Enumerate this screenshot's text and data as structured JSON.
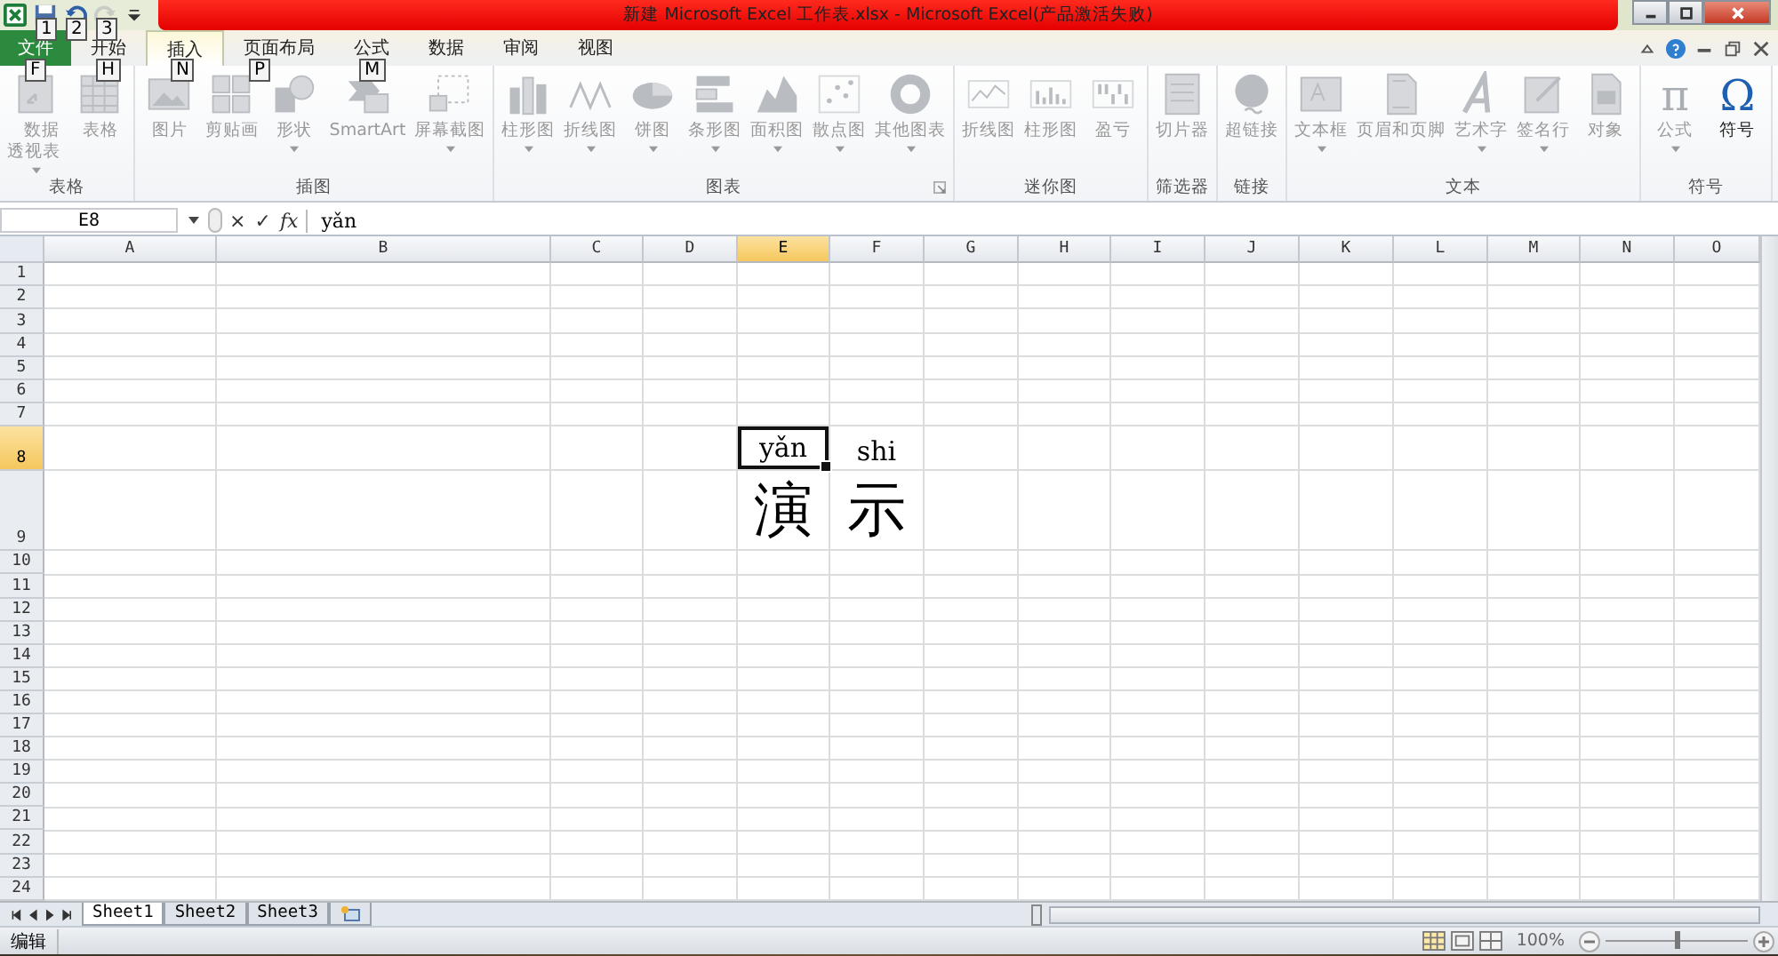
{
  "title_bar": {
    "title": "新建 Microsoft Excel 工作表.xlsx  -  Microsoft Excel(产品激活失败)"
  },
  "quick_access": [
    {
      "kind": "save",
      "keytip": "1",
      "disabled": false
    },
    {
      "kind": "undo",
      "keytip": "2",
      "disabled": false
    },
    {
      "kind": "redo",
      "keytip": "3",
      "disabled": true
    }
  ],
  "ribbon_tabs": [
    {
      "label": "文件",
      "kind": "file",
      "keytip": "F",
      "selected": false
    },
    {
      "label": "开始",
      "kind": "tab",
      "keytip": "H",
      "selected": false
    },
    {
      "label": "插入",
      "kind": "tab",
      "keytip": "N",
      "selected": true
    },
    {
      "label": "页面布局",
      "kind": "tab",
      "keytip": "P",
      "selected": false
    },
    {
      "label": "公式",
      "kind": "tab",
      "keytip": "M",
      "selected": false
    },
    {
      "label": "数据",
      "kind": "tab",
      "selected": false
    },
    {
      "label": "审阅",
      "kind": "tab",
      "selected": false
    },
    {
      "label": "视图",
      "kind": "tab",
      "selected": false
    }
  ],
  "ribbon_groups": [
    {
      "label": "表格",
      "buttons": [
        {
          "label": "数据透视表",
          "kind": "pivot",
          "disabled": true,
          "dropdown": true
        },
        {
          "label": "表格",
          "kind": "table",
          "disabled": true,
          "dropdown": false
        }
      ]
    },
    {
      "label": "插图",
      "buttons": [
        {
          "label": "图片",
          "kind": "picture",
          "disabled": true,
          "dropdown": false
        },
        {
          "label": "剪贴画",
          "kind": "clipart",
          "disabled": true,
          "dropdown": false
        },
        {
          "label": "形状",
          "kind": "shapes",
          "disabled": true,
          "dropdown": true
        },
        {
          "label": "SmartArt",
          "kind": "smartart",
          "disabled": true,
          "dropdown": false
        },
        {
          "label": "屏幕截图",
          "kind": "screenshot",
          "disabled": true,
          "dropdown": true
        }
      ]
    },
    {
      "label": "图表",
      "launcher": true,
      "buttons": [
        {
          "label": "柱形图",
          "kind": "column",
          "disabled": true,
          "dropdown": true
        },
        {
          "label": "折线图",
          "kind": "line",
          "disabled": true,
          "dropdown": true
        },
        {
          "label": "饼图",
          "kind": "pie",
          "disabled": true,
          "dropdown": true
        },
        {
          "label": "条形图",
          "kind": "bar",
          "disabled": true,
          "dropdown": true
        },
        {
          "label": "面积图",
          "kind": "area",
          "disabled": true,
          "dropdown": true
        },
        {
          "label": "散点图",
          "kind": "scatter",
          "disabled": true,
          "dropdown": true
        },
        {
          "label": "其他图表",
          "kind": "donut",
          "disabled": true,
          "dropdown": true
        }
      ]
    },
    {
      "label": "迷你图",
      "buttons": [
        {
          "label": "折线图",
          "kind": "sparkline",
          "disabled": true,
          "dropdown": false
        },
        {
          "label": "柱形图",
          "kind": "sparkcolumn",
          "disabled": true,
          "dropdown": false
        },
        {
          "label": "盈亏",
          "kind": "winloss",
          "disabled": true,
          "dropdown": false
        }
      ]
    },
    {
      "label": "筛选器",
      "buttons": [
        {
          "label": "切片器",
          "kind": "slicer",
          "disabled": true,
          "dropdown": false
        }
      ]
    },
    {
      "label": "链接",
      "buttons": [
        {
          "label": "超链接",
          "kind": "globe",
          "disabled": true,
          "dropdown": false
        }
      ]
    },
    {
      "label": "文本",
      "buttons": [
        {
          "label": "文本框",
          "kind": "textbox",
          "disabled": true,
          "dropdown": true
        },
        {
          "label": "页眉和页脚",
          "kind": "document",
          "disabled": true,
          "dropdown": false
        },
        {
          "label": "艺术字",
          "kind": "wordart",
          "disabled": true,
          "dropdown": true
        },
        {
          "label": "签名行",
          "kind": "signature",
          "disabled": true,
          "dropdown": true
        },
        {
          "label": "对象",
          "kind": "object",
          "disabled": true,
          "dropdown": false
        }
      ]
    },
    {
      "label": "符号",
      "buttons": [
        {
          "label": "公式",
          "kind": "glyph",
          "glyph": "π",
          "disabled": true,
          "dropdown": true
        },
        {
          "label": "符号",
          "kind": "glyph",
          "glyph": "Ω",
          "disabled": false,
          "dropdown": false
        }
      ]
    }
  ],
  "formula_bar": {
    "name_box": "E8",
    "cancel": "×",
    "enter": "✓",
    "function": "fx",
    "value": "yǎn"
  },
  "columns": [
    {
      "label": "A",
      "selected": false
    },
    {
      "label": "B",
      "selected": false
    },
    {
      "label": "C",
      "selected": false
    },
    {
      "label": "D",
      "selected": false
    },
    {
      "label": "E",
      "selected": true
    },
    {
      "label": "F",
      "selected": false
    },
    {
      "label": "G",
      "selected": false
    },
    {
      "label": "H",
      "selected": false
    },
    {
      "label": "I",
      "selected": false
    },
    {
      "label": "J",
      "selected": false
    },
    {
      "label": "K",
      "selected": false
    },
    {
      "label": "L",
      "selected": false
    },
    {
      "label": "M",
      "selected": false
    },
    {
      "label": "N",
      "selected": false
    },
    {
      "label": "O",
      "selected": false
    }
  ],
  "rows": [
    {
      "header": "1",
      "selected": false
    },
    {
      "header": "2",
      "selected": false
    },
    {
      "header": "3",
      "selected": false
    },
    {
      "header": "4",
      "selected": false
    },
    {
      "header": "5",
      "selected": false
    },
    {
      "header": "6",
      "selected": false
    },
    {
      "header": "7",
      "selected": false
    },
    {
      "header": "8",
      "selected": true,
      "cells": [
        null,
        null,
        null,
        null,
        {
          "text": "yǎn",
          "kind": "pinyin",
          "selected": true
        },
        {
          "text": "shi",
          "kind": "pinyin",
          "selected": false
        }
      ]
    },
    {
      "header": "9",
      "selected": false,
      "cells": [
        null,
        null,
        null,
        null,
        {
          "text": "演",
          "kind": "character",
          "selected": false
        },
        {
          "text": "示",
          "kind": "character",
          "selected": false
        }
      ]
    },
    {
      "header": "10",
      "selected": false
    },
    {
      "header": "11",
      "selected": false
    },
    {
      "header": "12",
      "selected": false
    },
    {
      "header": "13",
      "selected": false
    },
    {
      "header": "14",
      "selected": false
    },
    {
      "header": "15",
      "selected": false
    },
    {
      "header": "16",
      "selected": false
    },
    {
      "header": "17",
      "selected": false
    },
    {
      "header": "18",
      "selected": false
    },
    {
      "header": "19",
      "selected": false
    },
    {
      "header": "20",
      "selected": false
    },
    {
      "header": "21",
      "selected": false
    },
    {
      "header": "22",
      "selected": false
    },
    {
      "header": "23",
      "selected": false
    },
    {
      "header": "24",
      "selected": false
    }
  ],
  "sheet_tabs": [
    {
      "label": "Sheet1",
      "selected": true
    },
    {
      "label": "Sheet2",
      "selected": false
    },
    {
      "label": "Sheet3",
      "selected": false
    }
  ],
  "status_bar": {
    "mode": "编辑",
    "views": [
      {
        "kind": "normal",
        "selected": true
      },
      {
        "kind": "layout",
        "selected": false
      },
      {
        "kind": "pagebreak",
        "selected": false
      }
    ],
    "zoom": "100%",
    "zoom_level": {
      "level": 0.5
    }
  }
}
